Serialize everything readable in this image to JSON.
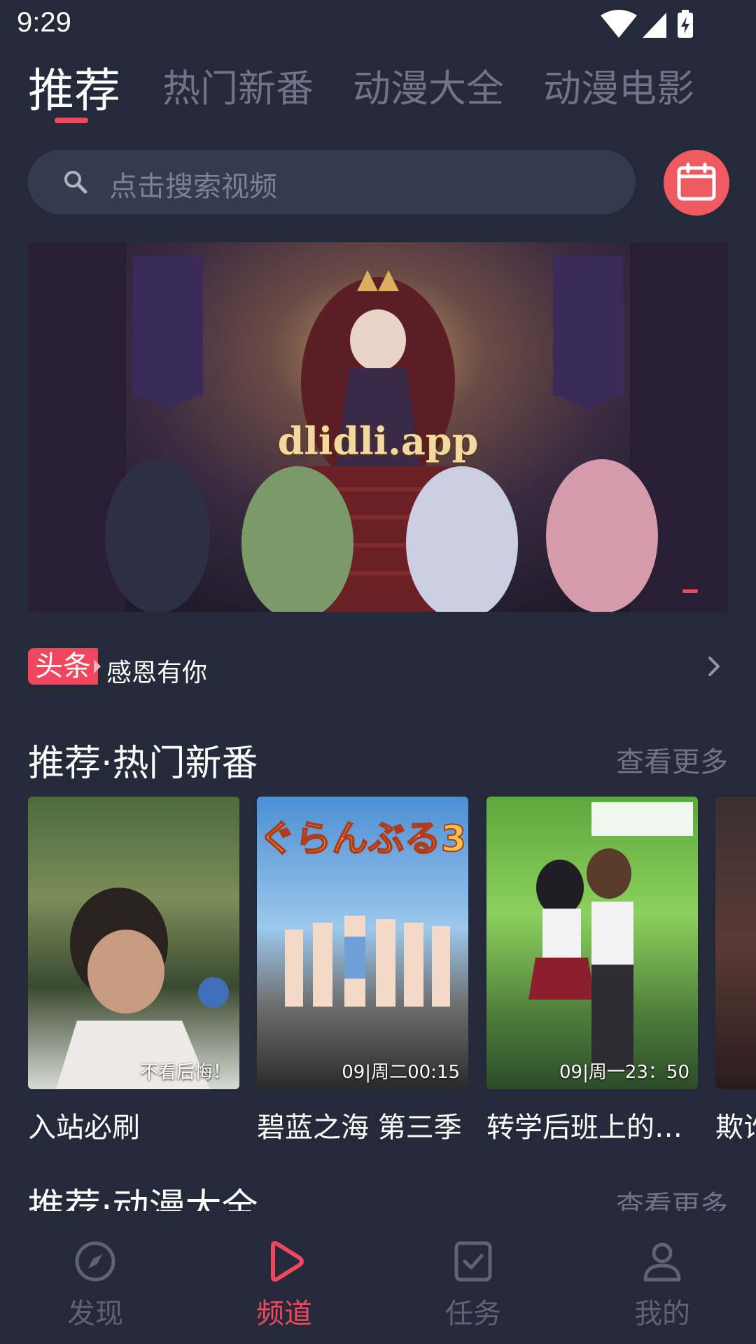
{
  "status_bar": {
    "time": "9:29"
  },
  "top_tabs": [
    {
      "label": "推荐",
      "active": true
    },
    {
      "label": "热门新番",
      "active": false
    },
    {
      "label": "动漫大全",
      "active": false
    },
    {
      "label": "动漫电影",
      "active": false
    }
  ],
  "search": {
    "placeholder": "点击搜索视频",
    "icon": "search-icon"
  },
  "calendar": {
    "icon": "calendar-icon"
  },
  "banner": {
    "watermark": "dlidli.app"
  },
  "news": {
    "badge": "头条",
    "text": "感恩有你"
  },
  "sections": [
    {
      "title": "推荐·热门新番",
      "more": "查看更多",
      "cards": [
        {
          "title": "入站必刷",
          "badge": "不看后悔！"
        },
        {
          "title": "碧蓝之海 第三季",
          "badge": "09|周二00:15"
        },
        {
          "title": "转学后班上的…",
          "badge": "09|周一23：50"
        },
        {
          "title": "欺诈",
          "badge": ""
        }
      ]
    },
    {
      "title": "推荐·动漫大全",
      "more": "查看更多"
    }
  ],
  "bottom_nav": [
    {
      "label": "发现",
      "icon": "compass-icon",
      "active": false
    },
    {
      "label": "频道",
      "icon": "play-icon",
      "active": true
    },
    {
      "label": "任务",
      "icon": "task-check-icon",
      "active": false
    },
    {
      "label": "我的",
      "icon": "user-icon",
      "active": false
    }
  ],
  "colors": {
    "background": "#252a3a",
    "accent": "#f0475e",
    "inactive": "#6e7588",
    "calendar_bg": "#ef5a60"
  }
}
